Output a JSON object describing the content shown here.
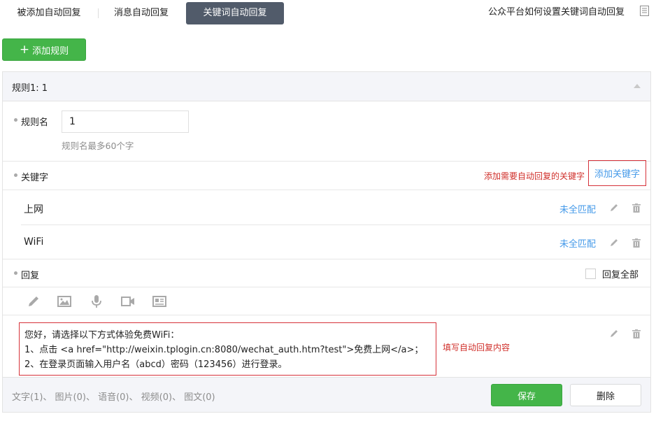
{
  "tabs": [
    {
      "label": "被添加自动回复"
    },
    {
      "label": "消息自动回复"
    },
    {
      "label": "关键词自动回复",
      "active": true
    }
  ],
  "help_link": "公众平台如何设置关键词自动回复",
  "add_rule_label": "添加规则",
  "rule": {
    "title": "规则1: 1",
    "name_label": "规则名",
    "name_value": "1",
    "name_hint": "规则名最多60个字",
    "keyword_label": "关键字",
    "keyword_hint": "添加需要自动回复的关键字",
    "add_keyword_label": "添加关键字",
    "keywords": [
      {
        "text": "上网",
        "match": "未全匹配"
      },
      {
        "text": "WiFi",
        "match": "未全匹配"
      }
    ],
    "reply_label": "回复",
    "reply_all_label": "回复全部",
    "reply_all_checked": false,
    "reply_lines": [
      "您好，请选择以下方式体验免费WiFi：",
      "1、点击 <a href=\"http://weixin.tplogin.cn:8080/wechat_auth.htm?test\">免费上网</a>；",
      "2、在登录页面输入用户名（abcd）密码（123456）进行登录。"
    ],
    "reply_hint": "填写自动回复内容",
    "counts": "文字(1)、 图片(0)、 语音(0)、 视频(0)、 图文(0)",
    "save_label": "保存",
    "delete_label": "删除"
  },
  "colors": {
    "accent_green": "#44b549",
    "link_blue": "#459ae9",
    "hint_red": "#d0302b",
    "active_tab": "#515b6a"
  }
}
